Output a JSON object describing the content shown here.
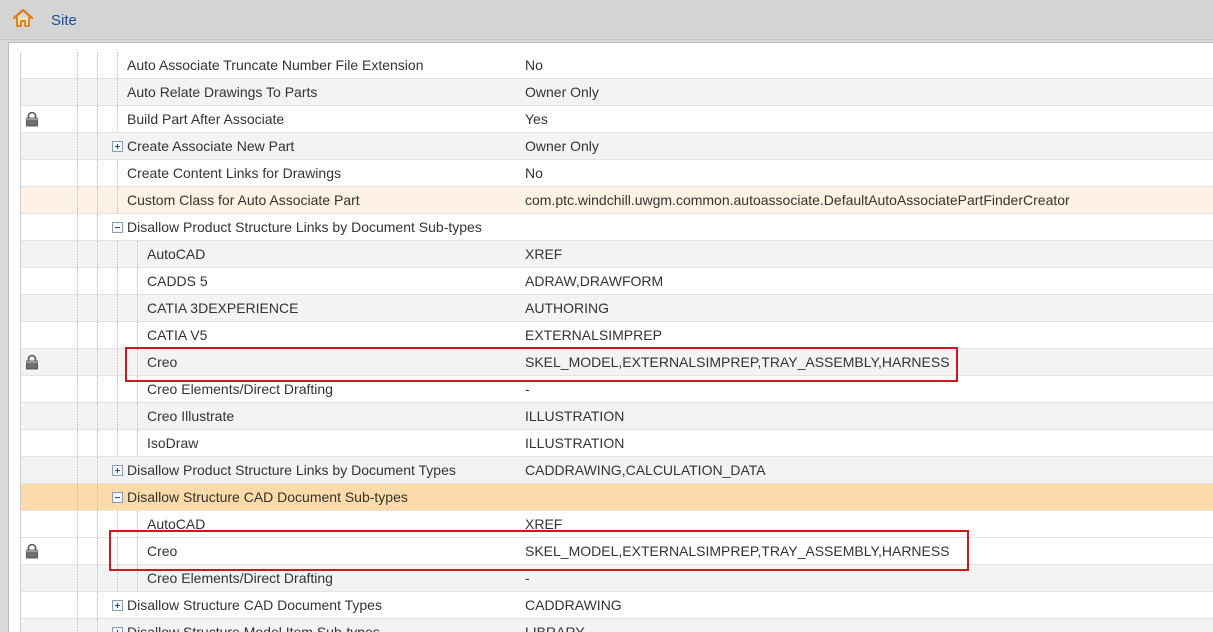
{
  "header": {
    "site_label": "Site"
  },
  "icons": {
    "home": "home-icon",
    "lock": "lock-icon",
    "expand": "expand-icon",
    "collapse": "collapse-icon"
  },
  "colors": {
    "highlight_light": "#fdf2e3",
    "highlight_strong": "#fbdba9",
    "annotation_red": "#d0161e",
    "link": "#1f4e96"
  },
  "rows": [
    {
      "name": "Auto Associate Truncate Number File Extension",
      "value": "No"
    },
    {
      "name": "Auto Relate Drawings To Parts",
      "value": "Owner Only"
    },
    {
      "name": "Build Part After Associate",
      "value": "Yes"
    },
    {
      "name": "Create Associate New Part",
      "value": "Owner Only"
    },
    {
      "name": "Create Content Links for Drawings",
      "value": "No"
    },
    {
      "name": "Custom Class for Auto Associate Part",
      "value": "com.ptc.windchill.uwgm.common.autoassociate.DefaultAutoAssociatePartFinderCreator"
    },
    {
      "name": "Disallow Product Structure Links by Document Sub-types",
      "value": ""
    },
    {
      "name": "AutoCAD",
      "value": "XREF"
    },
    {
      "name": "CADDS 5",
      "value": "ADRAW,DRAWFORM"
    },
    {
      "name": "CATIA 3DEXPERIENCE",
      "value": "AUTHORING"
    },
    {
      "name": "CATIA V5",
      "value": "EXTERNALSIMPREP"
    },
    {
      "name": "Creo",
      "value": "SKEL_MODEL,EXTERNALSIMPREP,TRAY_ASSEMBLY,HARNESS"
    },
    {
      "name": "Creo Elements/Direct Drafting",
      "value": "-"
    },
    {
      "name": "Creo Illustrate",
      "value": "ILLUSTRATION"
    },
    {
      "name": "IsoDraw",
      "value": "ILLUSTRATION"
    },
    {
      "name": "Disallow Product Structure Links by Document Types",
      "value": "CADDRAWING,CALCULATION_DATA"
    },
    {
      "name": "Disallow Structure CAD Document Sub-types",
      "value": ""
    },
    {
      "name": "AutoCAD",
      "value": "XREF"
    },
    {
      "name": "Creo",
      "value": "SKEL_MODEL,EXTERNALSIMPREP,TRAY_ASSEMBLY,HARNESS"
    },
    {
      "name": "Creo Elements/Direct Drafting",
      "value": "-"
    },
    {
      "name": "Disallow Structure CAD Document Types",
      "value": "CADDRAWING"
    },
    {
      "name": "Disallow Structure Model Item Sub-types",
      "value": "LIBRARY"
    }
  ]
}
